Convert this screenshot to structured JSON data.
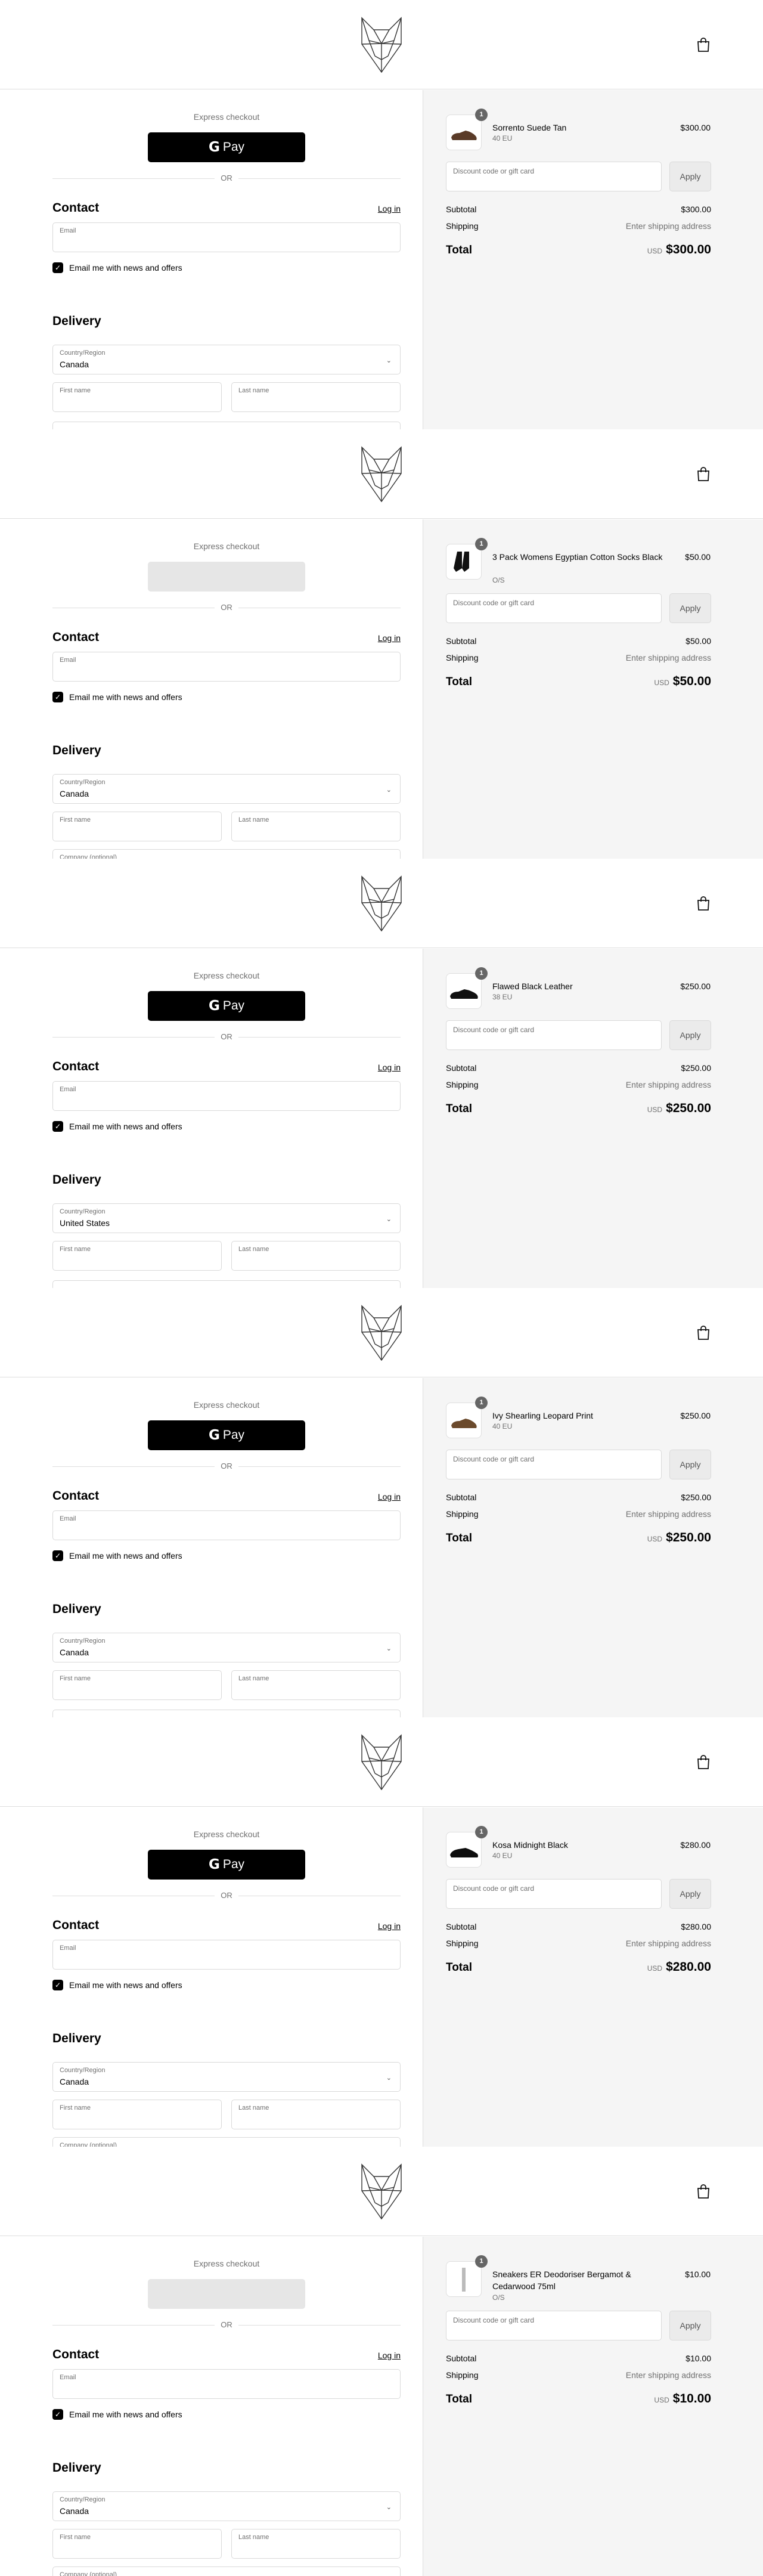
{
  "colors": {
    "accent": "#000000",
    "summary_bg": "#f5f5f5",
    "border": "#dedede",
    "muted_text": "#707070"
  },
  "icons": {
    "logo": "wolf-logo-icon",
    "cart": "shopping-bag-icon",
    "gpay": "google-pay-icon",
    "checkbox": "check-icon",
    "select": "chevron-down-icon"
  },
  "panels": [
    {
      "left": {
        "express_title": "Express checkout",
        "show_gpay": true,
        "gpay_label": "Pay",
        "gpay_g": "G",
        "or_label": "OR",
        "contact_heading": "Contact",
        "login_link": "Log in",
        "email_label": "Email",
        "newsletter_label": "Email me with news and offers",
        "newsletter_checked": true,
        "delivery_heading": "Delivery",
        "country_label": "Country/Region",
        "country_value": "Canada",
        "first_name_label": "First name",
        "last_name_label": "Last name",
        "company_label": ""
      },
      "right": {
        "product_name": "Sorrento Suede Tan",
        "variant": "40 EU",
        "price": "$300.00",
        "quantity": "1",
        "discount_placeholder": "Discount code or gift card",
        "apply_label": "Apply",
        "subtotal_label": "Subtotal",
        "subtotal_value": "$300.00",
        "shipping_label": "Shipping",
        "shipping_value": "Enter shipping address",
        "total_label": "Total",
        "currency": "USD",
        "total_value": "$300.00"
      }
    },
    {
      "left": {
        "express_title": "Express checkout",
        "show_gpay": false,
        "gpay_label": "",
        "gpay_g": "",
        "or_label": "OR",
        "contact_heading": "Contact",
        "login_link": "Log in",
        "email_label": "Email",
        "newsletter_label": "Email me with news and offers",
        "newsletter_checked": true,
        "delivery_heading": "Delivery",
        "country_label": "Country/Region",
        "country_value": "Canada",
        "first_name_label": "First name",
        "last_name_label": "Last name",
        "company_label": "Company (optional)"
      },
      "right": {
        "product_name": "3 Pack Womens Egyptian Cotton Socks Black",
        "variant": "O/S",
        "price": "$50.00",
        "quantity": "1",
        "discount_placeholder": "Discount code or gift card",
        "apply_label": "Apply",
        "subtotal_label": "Subtotal",
        "subtotal_value": "$50.00",
        "shipping_label": "Shipping",
        "shipping_value": "Enter shipping address",
        "total_label": "Total",
        "currency": "USD",
        "total_value": "$50.00"
      }
    },
    {
      "left": {
        "express_title": "Express checkout",
        "show_gpay": true,
        "gpay_label": "Pay",
        "gpay_g": "G",
        "or_label": "OR",
        "contact_heading": "Contact",
        "login_link": "Log in",
        "email_label": "Email",
        "newsletter_label": "Email me with news and offers",
        "newsletter_checked": true,
        "delivery_heading": "Delivery",
        "country_label": "Country/Region",
        "country_value": "United States",
        "first_name_label": "First name",
        "last_name_label": "Last name",
        "company_label": ""
      },
      "right": {
        "product_name": "Flawed Black Leather",
        "variant": "38 EU",
        "price": "$250.00",
        "quantity": "1",
        "discount_placeholder": "Discount code or gift card",
        "apply_label": "Apply",
        "subtotal_label": "Subtotal",
        "subtotal_value": "$250.00",
        "shipping_label": "Shipping",
        "shipping_value": "Enter shipping address",
        "total_label": "Total",
        "currency": "USD",
        "total_value": "$250.00"
      }
    },
    {
      "left": {
        "express_title": "Express checkout",
        "show_gpay": true,
        "gpay_label": "Pay",
        "gpay_g": "G",
        "or_label": "OR",
        "contact_heading": "Contact",
        "login_link": "Log in",
        "email_label": "Email",
        "newsletter_label": "Email me with news and offers",
        "newsletter_checked": true,
        "delivery_heading": "Delivery",
        "country_label": "Country/Region",
        "country_value": "Canada",
        "first_name_label": "First name",
        "last_name_label": "Last name",
        "company_label": ""
      },
      "right": {
        "product_name": "Ivy Shearling Leopard Print",
        "variant": "40 EU",
        "price": "$250.00",
        "quantity": "1",
        "discount_placeholder": "Discount code or gift card",
        "apply_label": "Apply",
        "subtotal_label": "Subtotal",
        "subtotal_value": "$250.00",
        "shipping_label": "Shipping",
        "shipping_value": "Enter shipping address",
        "total_label": "Total",
        "currency": "USD",
        "total_value": "$250.00"
      }
    },
    {
      "left": {
        "express_title": "Express checkout",
        "show_gpay": true,
        "gpay_label": "Pay",
        "gpay_g": "G",
        "or_label": "OR",
        "contact_heading": "Contact",
        "login_link": "Log in",
        "email_label": "Email",
        "newsletter_label": "Email me with news and offers",
        "newsletter_checked": true,
        "delivery_heading": "Delivery",
        "country_label": "Country/Region",
        "country_value": "Canada",
        "first_name_label": "First name",
        "last_name_label": "Last name",
        "company_label": "Company (optional)"
      },
      "right": {
        "product_name": "Kosa Midnight Black",
        "variant": "40 EU",
        "price": "$280.00",
        "quantity": "1",
        "discount_placeholder": "Discount code or gift card",
        "apply_label": "Apply",
        "subtotal_label": "Subtotal",
        "subtotal_value": "$280.00",
        "shipping_label": "Shipping",
        "shipping_value": "Enter shipping address",
        "total_label": "Total",
        "currency": "USD",
        "total_value": "$280.00"
      }
    },
    {
      "left": {
        "express_title": "Express checkout",
        "show_gpay": false,
        "gpay_label": "",
        "gpay_g": "",
        "or_label": "OR",
        "contact_heading": "Contact",
        "login_link": "Log in",
        "email_label": "Email",
        "newsletter_label": "Email me with news and offers",
        "newsletter_checked": true,
        "delivery_heading": "Delivery",
        "country_label": "Country/Region",
        "country_value": "Canada",
        "first_name_label": "First name",
        "last_name_label": "Last name",
        "company_label": "Company (optional)"
      },
      "right": {
        "product_name": "Sneakers ER Deodoriser Bergamot & Cedarwood 75ml",
        "variant": "O/S",
        "price": "$10.00",
        "quantity": "1",
        "discount_placeholder": "Discount code or gift card",
        "apply_label": "Apply",
        "subtotal_label": "Subtotal",
        "subtotal_value": "$10.00",
        "shipping_label": "Shipping",
        "shipping_value": "Enter shipping address",
        "total_label": "Total",
        "currency": "USD",
        "total_value": "$10.00"
      }
    }
  ]
}
